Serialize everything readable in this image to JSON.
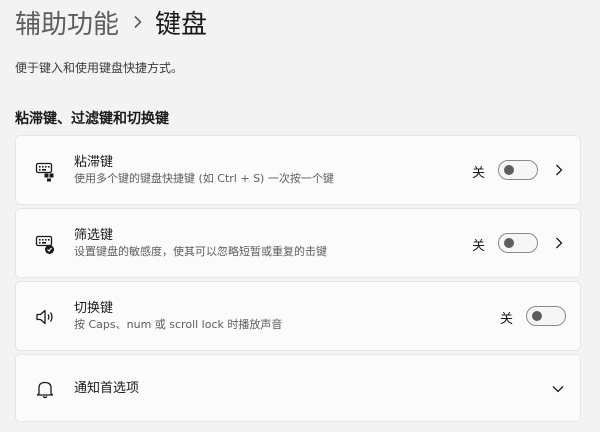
{
  "breadcrumb": {
    "parent": "辅助功能",
    "current": "键盘"
  },
  "description": "便于键入和使用键盘快捷方式。",
  "section_title": "粘滞键、过滤键和切换键",
  "cards": [
    {
      "title": "粘滞键",
      "subtitle": "使用多个键的键盘快捷键 (如 Ctrl + S) 一次按一个键",
      "state": "关",
      "icon": "sticky-keys-icon"
    },
    {
      "title": "筛选键",
      "subtitle": "设置键盘的敏感度，使其可以忽略短暂或重复的击键",
      "state": "关",
      "icon": "filter-keys-icon"
    },
    {
      "title": "切换键",
      "subtitle": "按 Caps、num 或 scroll lock 时播放声音",
      "state": "关",
      "icon": "speaker-icon"
    },
    {
      "title": "通知首选项",
      "icon": "bell-icon"
    }
  ],
  "colors": {
    "background": "#f3f3f3",
    "card": "#fbfbfb",
    "card_border": "#e5e5e5",
    "text": "#1a1a1a",
    "secondary_text": "#5d5d5d",
    "toggle_off_knob": "#5d5d5d"
  }
}
